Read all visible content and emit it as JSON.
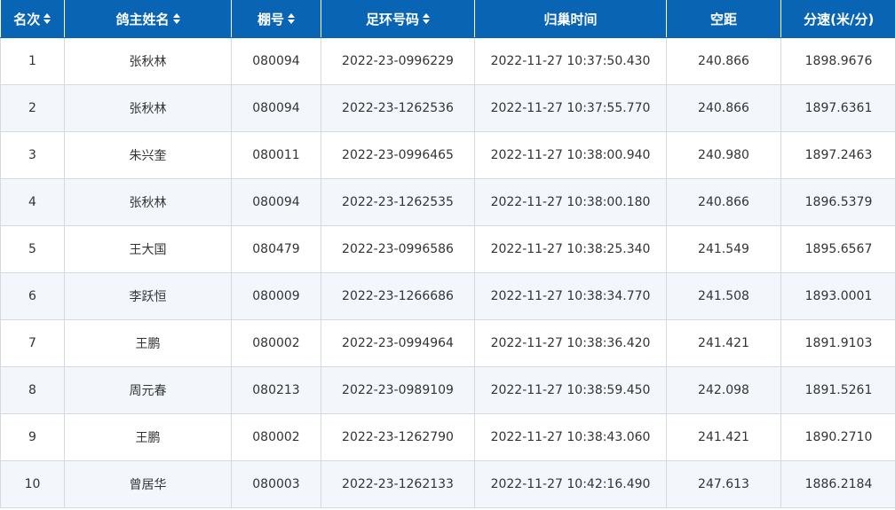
{
  "colors": {
    "header_bg": "#0a64b4",
    "header_text": "#ffffff",
    "row_alt_bg": "#f3f7fc",
    "border": "#d5d9e0",
    "cell_text": "#333333"
  },
  "table": {
    "columns": [
      {
        "label": "名次",
        "sortable": true
      },
      {
        "label": "鸽主姓名",
        "sortable": true
      },
      {
        "label": "棚号",
        "sortable": true
      },
      {
        "label": "足环号码",
        "sortable": true
      },
      {
        "label": "归巢时间",
        "sortable": false
      },
      {
        "label": "空距",
        "sortable": false
      },
      {
        "label": "分速(米/分)",
        "sortable": false
      }
    ],
    "sort_icon": "sort-up-down-icon",
    "rows": [
      [
        "1",
        "张秋林",
        "080094",
        "2022-23-0996229",
        "2022-11-27 10:37:50.430",
        "240.866",
        "1898.9676"
      ],
      [
        "2",
        "张秋林",
        "080094",
        "2022-23-1262536",
        "2022-11-27 10:37:55.770",
        "240.866",
        "1897.6361"
      ],
      [
        "3",
        "朱兴奎",
        "080011",
        "2022-23-0996465",
        "2022-11-27 10:38:00.940",
        "240.980",
        "1897.2463"
      ],
      [
        "4",
        "张秋林",
        "080094",
        "2022-23-1262535",
        "2022-11-27 10:38:00.180",
        "240.866",
        "1896.5379"
      ],
      [
        "5",
        "王大国",
        "080479",
        "2022-23-0996586",
        "2022-11-27 10:38:25.340",
        "241.549",
        "1895.6567"
      ],
      [
        "6",
        "李跃恒",
        "080009",
        "2022-23-1266686",
        "2022-11-27 10:38:34.770",
        "241.508",
        "1893.0001"
      ],
      [
        "7",
        "王鹏",
        "080002",
        "2022-23-0994964",
        "2022-11-27 10:38:36.420",
        "241.421",
        "1891.9103"
      ],
      [
        "8",
        "周元春",
        "080213",
        "2022-23-0989109",
        "2022-11-27 10:38:59.450",
        "242.098",
        "1891.5261"
      ],
      [
        "9",
        "王鹏",
        "080002",
        "2022-23-1262790",
        "2022-11-27 10:38:43.060",
        "241.421",
        "1890.2710"
      ],
      [
        "10",
        "曾居华",
        "080003",
        "2022-23-1262133",
        "2022-11-27 10:42:16.490",
        "247.613",
        "1886.2184"
      ]
    ]
  }
}
